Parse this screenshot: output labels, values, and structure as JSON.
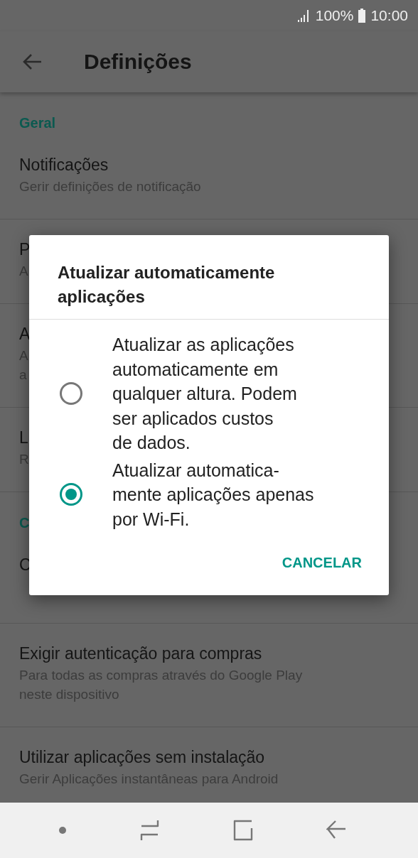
{
  "status_bar": {
    "battery": "100%",
    "time": "10:00"
  },
  "toolbar": {
    "title": "Definições"
  },
  "sections": [
    {
      "header": "Geral",
      "items": [
        {
          "title": "Notificações",
          "subtitle_lines": [
            "Gerir definições de notificação"
          ]
        },
        {
          "title": "P",
          "subtitle_lines": [
            "A"
          ]
        },
        {
          "title": "A",
          "subtitle_lines": [
            "A",
            "a"
          ]
        },
        {
          "title": "L",
          "subtitle_lines": [
            "R"
          ]
        }
      ]
    },
    {
      "header": "C",
      "items": [
        {
          "title": "C"
        },
        {
          "title": "Exigir autenticação para compras",
          "subtitle_lines": [
            "Para todas as compras através do Google Play",
            "neste dispositivo"
          ]
        },
        {
          "title": "Utilizar aplicações sem instalação",
          "subtitle_lines": [
            "Gerir Aplicações instantâneas para Android"
          ]
        }
      ]
    }
  ],
  "dialog": {
    "title_lines": [
      "Atualizar automaticamente",
      "aplicações"
    ],
    "options": [
      {
        "label_lines": [
          "Atualizar as aplicações",
          "automaticamente em",
          "qualquer altura. Podem",
          "ser aplicados custos",
          "de dados."
        ],
        "selected": false
      },
      {
        "label_lines": [
          "Atualizar automatica-",
          "mente aplicações apenas",
          "por Wi-Fi."
        ],
        "selected": true
      }
    ],
    "buttons": [
      "CANCELAR"
    ]
  }
}
